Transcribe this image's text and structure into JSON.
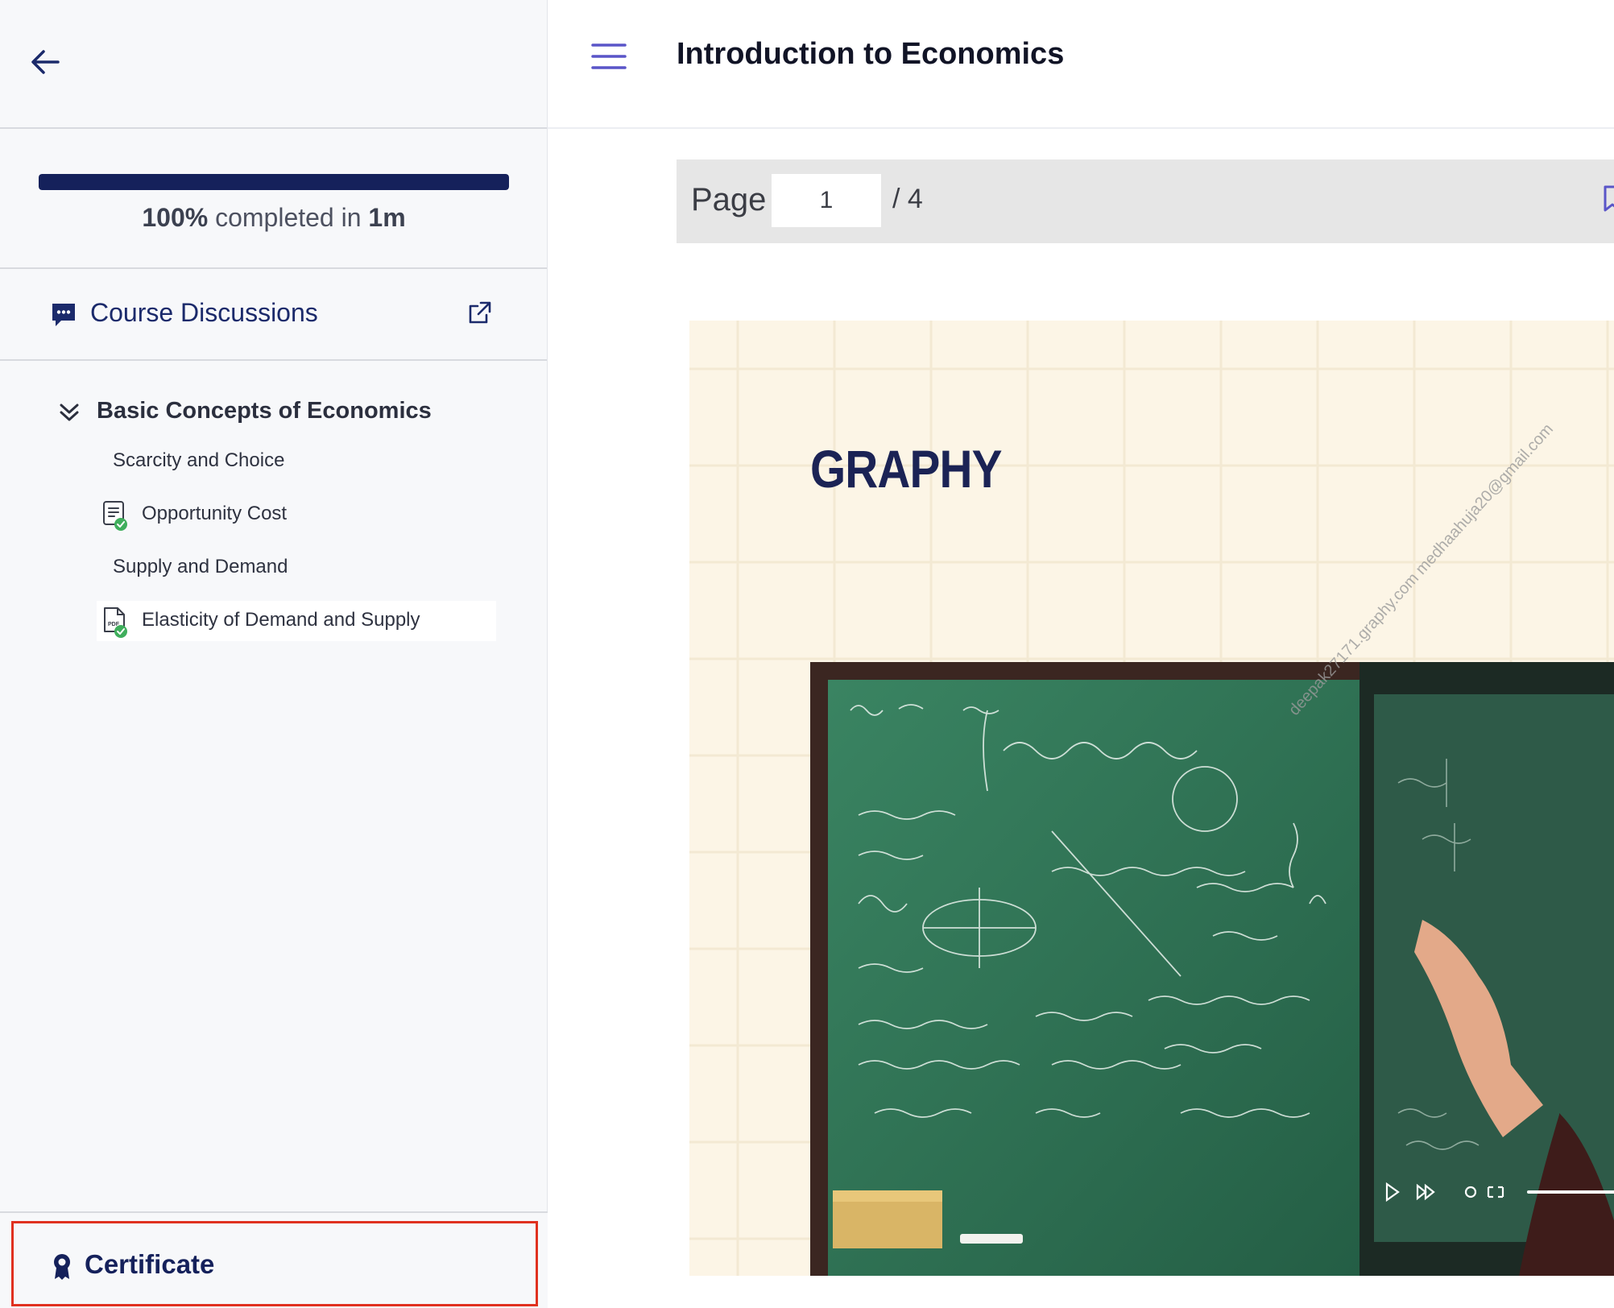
{
  "header": {
    "title": "Introduction to Economics"
  },
  "progress": {
    "percent_label": "100%",
    "middle_text": "completed in",
    "duration": "1m",
    "fraction": 1.0
  },
  "discussions": {
    "label": "Course Discussions"
  },
  "chapter": {
    "title": "Basic Concepts of Economics",
    "lessons": [
      {
        "label": "Scarcity and Choice",
        "icon": null,
        "completed": false
      },
      {
        "label": "Opportunity Cost",
        "icon": "quiz-icon",
        "completed": true
      },
      {
        "label": "Supply and Demand",
        "icon": null,
        "completed": false
      },
      {
        "label": "Elasticity of Demand and Supply",
        "icon": "pdf-icon",
        "completed": true,
        "active": true
      }
    ]
  },
  "certificate": {
    "label": "Certificate"
  },
  "viewer": {
    "page_label": "Page",
    "page_current": "1",
    "page_total": "/ 4"
  },
  "document": {
    "brand": "GRAPHY",
    "watermark": "deepak27171.graphy.com medhaahuja20@gmail.com"
  },
  "colors": {
    "accent_navy": "#15215b",
    "menu_purple": "#5a55c8",
    "success_green": "#3fae5c",
    "highlight_red": "#e0311f"
  }
}
